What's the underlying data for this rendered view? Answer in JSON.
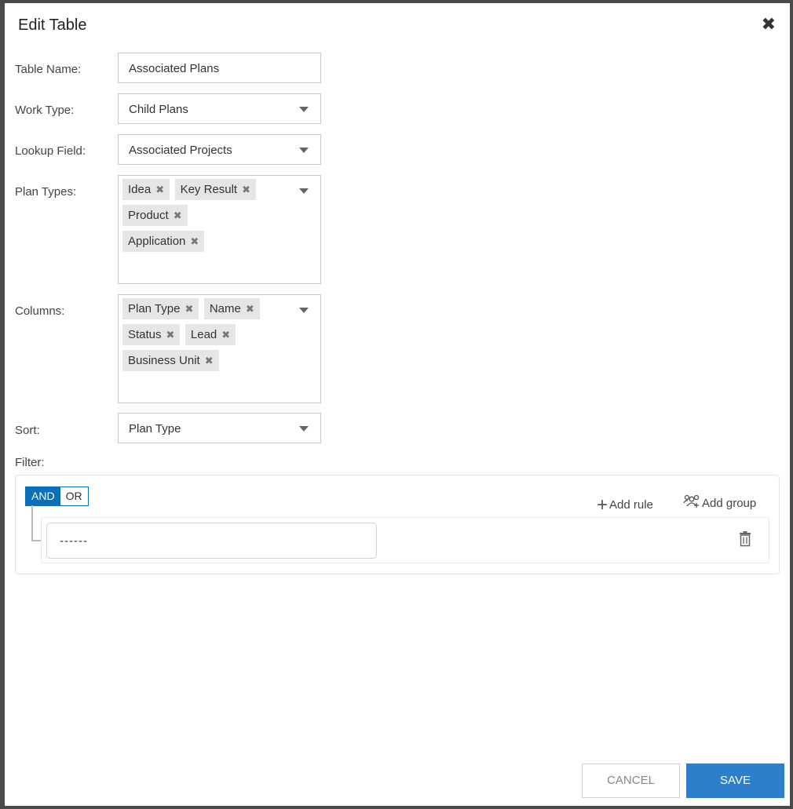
{
  "dialog": {
    "title": "Edit Table"
  },
  "form": {
    "table_name": {
      "label": "Table Name:",
      "value": "Associated Plans"
    },
    "work_type": {
      "label": "Work Type:",
      "value": "Child Plans"
    },
    "lookup_field": {
      "label": "Lookup Field:",
      "value": "Associated Projects"
    },
    "plan_types": {
      "label": "Plan Types:",
      "tags": [
        "Idea",
        "Key Result",
        "Product",
        "Application"
      ]
    },
    "columns": {
      "label": "Columns:",
      "tags": [
        "Plan Type",
        "Name",
        "Status",
        "Lead",
        "Business Unit"
      ]
    },
    "sort": {
      "label": "Sort:",
      "value": "Plan Type"
    },
    "filter": {
      "label": "Filter:",
      "and_label": "AND",
      "or_label": "OR",
      "add_rule_label": "Add rule",
      "add_group_label": "Add group",
      "rule_value": "------"
    }
  },
  "footer": {
    "cancel_label": "CANCEL",
    "save_label": "SAVE"
  },
  "colors": {
    "primary": "#2d7fcb",
    "and_active": "#0d6fb8"
  }
}
